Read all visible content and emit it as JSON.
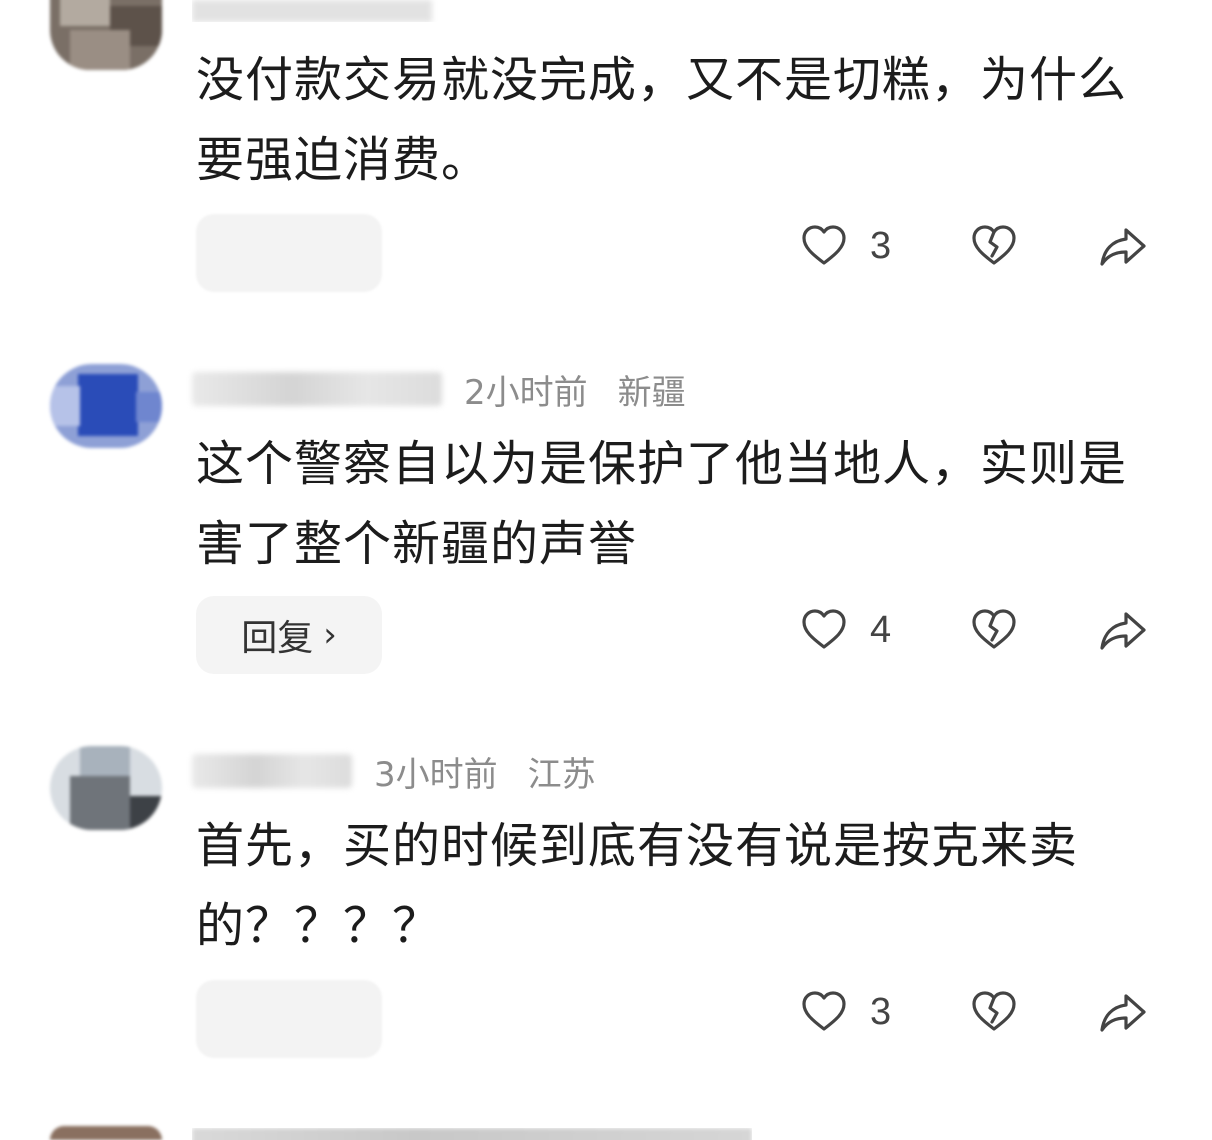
{
  "comments": [
    {
      "text": "没付款交易就没完成，又不是切糕，为什么要强迫消费。",
      "likes": "3",
      "reply_label": "",
      "time": "",
      "region": ""
    },
    {
      "text": "这个警察自以为是保护了他当地人，实则是害了整个新疆的声誉",
      "likes": "4",
      "reply_label": "回复",
      "reply_chevron": "›",
      "time": "2小时前",
      "region": "新疆"
    },
    {
      "text": "首先，买的时候到底有没有说是按克来卖的？？？？",
      "likes": "3",
      "reply_label": "",
      "time": "3小时前",
      "region": "江苏"
    }
  ],
  "icons": {
    "like": "heart-outline-icon",
    "dislike": "broken-heart-icon",
    "share": "share-arrow-icon"
  },
  "colors": {
    "text": "#1c1c1c",
    "meta": "#8c8c8c",
    "icon": "#444444",
    "pill": "#f4f4f4"
  }
}
